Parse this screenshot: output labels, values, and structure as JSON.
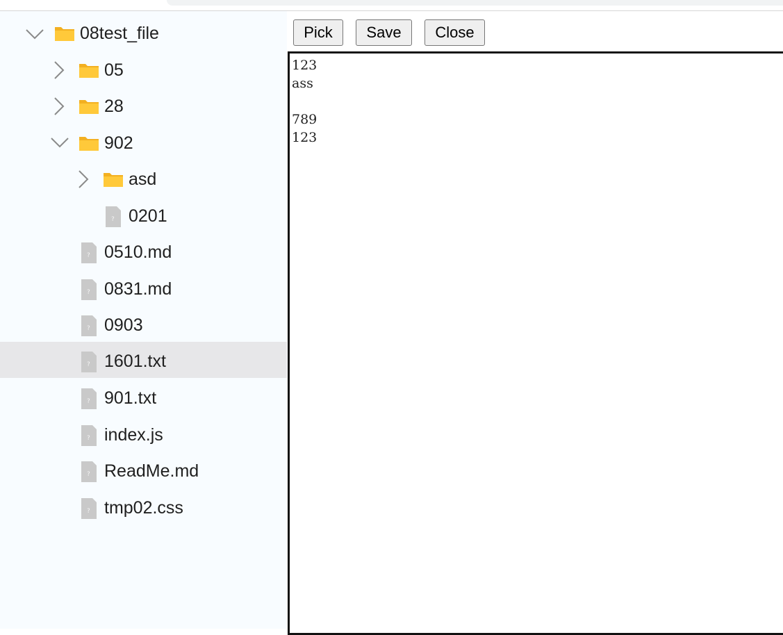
{
  "toolbar": {
    "pick_label": "Pick",
    "save_label": "Save",
    "close_label": "Close"
  },
  "tree": {
    "root": {
      "label": "08test_file",
      "expanded": true,
      "icon": "folder-icon"
    },
    "items": [
      {
        "label": "05",
        "type": "folder",
        "expanded": false
      },
      {
        "label": "28",
        "type": "folder",
        "expanded": false
      },
      {
        "label": "902",
        "type": "folder",
        "expanded": true
      },
      {
        "label": "asd",
        "type": "folder",
        "expanded": false
      },
      {
        "label": "0201",
        "type": "file"
      },
      {
        "label": "0510.md",
        "type": "file"
      },
      {
        "label": "0831.md",
        "type": "file"
      },
      {
        "label": "0903",
        "type": "file"
      },
      {
        "label": "1601.txt",
        "type": "file",
        "selected": true
      },
      {
        "label": "901.txt",
        "type": "file"
      },
      {
        "label": "index.js",
        "type": "file"
      },
      {
        "label": "ReadMe.md",
        "type": "file"
      },
      {
        "label": "tmp02.css",
        "type": "file"
      }
    ]
  },
  "editor": {
    "content": "123\nass\n\n789\n123"
  },
  "colors": {
    "sidebar_bg": "#f8fcff",
    "selected_row": "#e7e7e9",
    "folder_yellow": "#ffc93a",
    "file_grey": "#c9c9c9"
  }
}
